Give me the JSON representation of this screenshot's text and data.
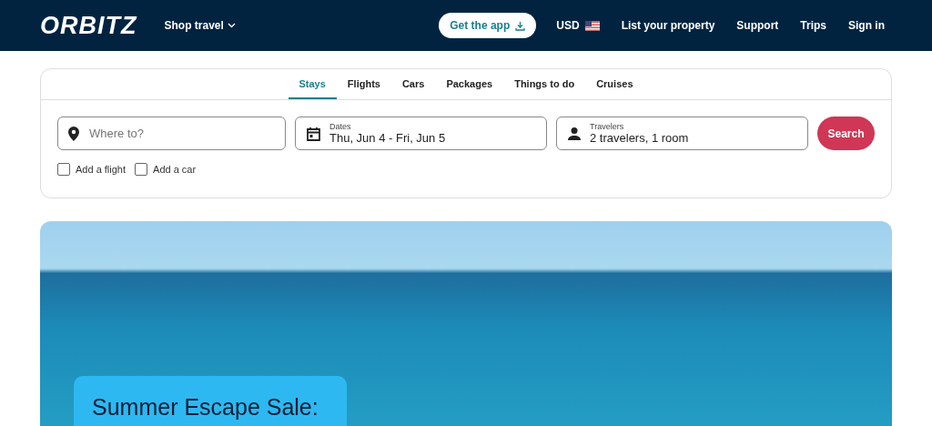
{
  "header": {
    "logo": "ORBITZ",
    "shop_travel": "Shop travel",
    "get_app": "Get the app",
    "currency": "USD",
    "links": [
      "List your property",
      "Support",
      "Trips",
      "Sign in"
    ]
  },
  "tabs": [
    {
      "label": "Stays",
      "selected": true
    },
    {
      "label": "Flights",
      "selected": false
    },
    {
      "label": "Cars",
      "selected": false
    },
    {
      "label": "Packages",
      "selected": false
    },
    {
      "label": "Things to do",
      "selected": false
    },
    {
      "label": "Cruises",
      "selected": false
    }
  ],
  "search": {
    "destination": {
      "placeholder": "Where to?"
    },
    "dates": {
      "label": "Dates",
      "value": "Thu, Jun 4 - Fri, Jun 5"
    },
    "travelers": {
      "label": "Travelers",
      "value": "2 travelers, 1 room"
    },
    "button": "Search"
  },
  "options": [
    {
      "label": "Add a flight",
      "checked": false
    },
    {
      "label": "Add a car",
      "checked": false
    }
  ],
  "hero": {
    "headline": "Summer Escape Sale:"
  }
}
